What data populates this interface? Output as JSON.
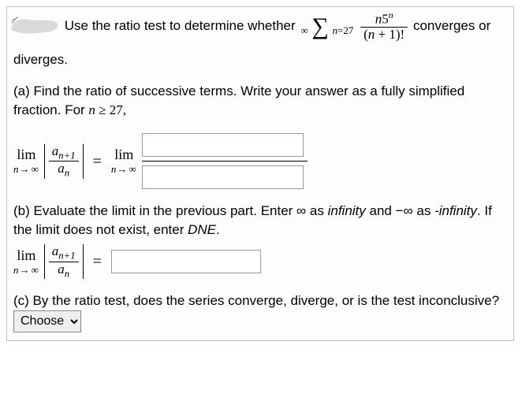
{
  "intro": {
    "lead": "Use the ratio test to determine whether",
    "sum_top": "∞",
    "sum_bottom_var": "n",
    "sum_bottom_eq": "=",
    "sum_bottom_num": "27",
    "frac_num_left": "n",
    "frac_num_base": "5",
    "frac_num_exp": "n",
    "frac_den_l": "(",
    "frac_den_var": "n",
    "frac_den_plus": " + 1)!",
    "tail1": "converges or",
    "tail2": "diverges."
  },
  "partA": {
    "prompt1": "(a) Find the ratio of successive terms. Write your answer as a fully simplified fraction. For ",
    "cond_var": "n",
    "cond_rest": " ≥ 27,",
    "lim": "lim",
    "limvar": "n",
    "limop": "→",
    "liminf": "∞",
    "a": "a",
    "np1": "n+1",
    "n": "n",
    "eq": "="
  },
  "partB": {
    "prompt1": "(b) Evaluate the limit in the previous part. Enter ∞ as ",
    "inf_word": "infinity",
    "prompt2": " and −∞ as ",
    "ninf_word": "-infinity",
    "prompt3": ". If the limit does not exist, enter ",
    "dne": "DNE",
    "prompt4": ".",
    "lim": "lim",
    "limvar": "n",
    "limop": "→",
    "liminf": "∞",
    "a": "a",
    "np1": "n+1",
    "n": "n",
    "eq": "="
  },
  "partC": {
    "prompt": "(c) By the ratio test, does the series converge, diverge, or is the test inconclusive?",
    "choose": "Choose"
  }
}
